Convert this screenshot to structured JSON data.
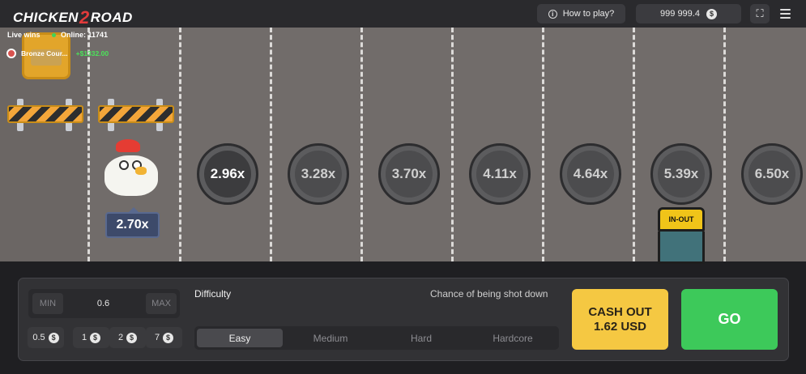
{
  "header": {
    "logo_left": "CHICKEN",
    "logo_mid": "2",
    "logo_right": "ROAD",
    "how_to_play": "How to play?",
    "balance": "999 999.4",
    "currency_symbol": "$"
  },
  "live": {
    "label": "Live wins",
    "online": "Online: 11741",
    "winner_name": "Bronze Cour...",
    "winner_amount": "+$1332.00"
  },
  "chicken": {
    "multiplier": "2.70x"
  },
  "lanes": {
    "multipliers": [
      "2.96x",
      "3.28x",
      "3.70x",
      "4.11x",
      "4.64x",
      "5.39x",
      "6.50x"
    ]
  },
  "truck": {
    "logo_text": "IN-OUT"
  },
  "bet": {
    "min_label": "MIN",
    "max_label": "MAX",
    "value": "0.6",
    "chips": [
      "0.5",
      "1",
      "2",
      "7"
    ]
  },
  "difficulty": {
    "label": "Difficulty",
    "chance_label": "Chance of being shot down",
    "options": [
      "Easy",
      "Medium",
      "Hard",
      "Hardcore"
    ],
    "selected": "Easy"
  },
  "actions": {
    "cashout_line1": "CASH OUT",
    "cashout_line2": "1.62 USD",
    "go": "GO"
  },
  "colors": {
    "road": "#716c6a",
    "cashout": "#f5c842",
    "go": "#3dc95a",
    "win_amount": "#4be35a"
  }
}
